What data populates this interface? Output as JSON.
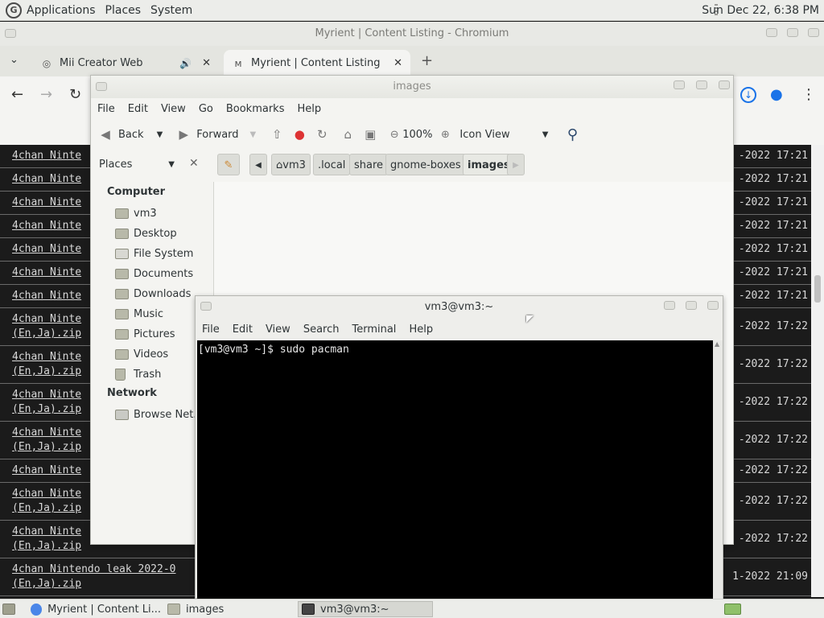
{
  "top_panel": {
    "menus": [
      "Applications",
      "Places",
      "System"
    ],
    "clock": "Sun Dec 22,  6:38 PM"
  },
  "chromium": {
    "window_title": "Myrient | Content Listing - Chromium",
    "tabs": [
      {
        "label": "Mii Creator Web",
        "audio": "🔊"
      },
      {
        "label": "Myrient | Content Listing"
      }
    ],
    "new_tab": "+",
    "rows": [
      {
        "name": "4chan Ninte",
        "date": "-2022 17:21"
      },
      {
        "name": "4chan Ninte",
        "date": "-2022 17:21"
      },
      {
        "name": "4chan Ninte",
        "date": "-2022 17:21"
      },
      {
        "name": "4chan Ninte",
        "date": "-2022 17:21"
      },
      {
        "name": "4chan Ninte",
        "date": "-2022 17:21"
      },
      {
        "name": "4chan Ninte",
        "date": "-2022 17:21"
      },
      {
        "name": "4chan Ninte",
        "date": "-2022 17:21"
      },
      {
        "name": "4chan Ninte",
        "name2": "(En,Ja).zip",
        "date": "-2022 17:22"
      },
      {
        "name": "4chan Ninte",
        "name2": "(En,Ja).zip",
        "date": "-2022 17:22"
      },
      {
        "name": "4chan Ninte",
        "name2": "(En,Ja).zip",
        "date": "-2022 17:22"
      },
      {
        "name": "4chan Ninte",
        "name2": "(En,Ja).zip",
        "date": "-2022 17:22"
      },
      {
        "name": "4chan Ninte",
        "date": "-2022 17:22"
      },
      {
        "name": "4chan Ninte",
        "name2": "(En,Ja).zip",
        "date": "-2022 17:22"
      },
      {
        "name": "4chan Ninte",
        "name2": "(En,Ja).zip",
        "date": "-2022 17:22"
      },
      {
        "name": "4chan Nintendo leak 2022-0",
        "name2": "(En,Ja).zip",
        "date": "1-2022 21:09"
      }
    ]
  },
  "file_manager": {
    "title": "images",
    "menus": [
      "File",
      "Edit",
      "View",
      "Go",
      "Bookmarks",
      "Help"
    ],
    "toolbar": {
      "back": "Back",
      "forward": "Forward",
      "zoom": "100%",
      "view_mode": "Icon View"
    },
    "places_label": "Places",
    "breadcrumbs": [
      "vm3",
      ".local",
      "share",
      "gnome-boxes",
      "images"
    ],
    "sidebar": {
      "computer_header": "Computer",
      "computer_items": [
        "vm3",
        "Desktop",
        "File System",
        "Documents",
        "Downloads",
        "Music",
        "Pictures",
        "Videos",
        "Trash"
      ],
      "network_header": "Network",
      "network_items": [
        "Browse Net..."
      ]
    }
  },
  "terminal": {
    "title": "vm3@vm3:~",
    "menus": [
      "File",
      "Edit",
      "View",
      "Search",
      "Terminal",
      "Help"
    ],
    "line": "[vm3@vm3 ~]$ sudo pacman"
  },
  "taskbar": {
    "tasks": [
      "Myrient | Content Li...",
      "images",
      "vm3@vm3:~"
    ]
  }
}
